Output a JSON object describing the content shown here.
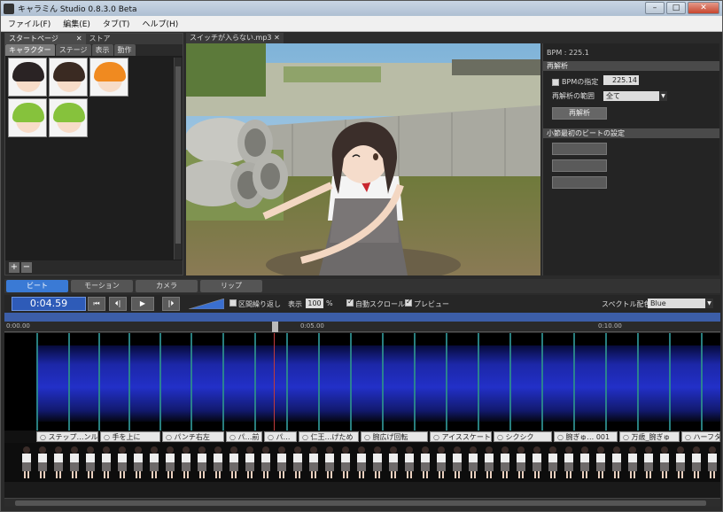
{
  "window": {
    "title": "キャラミん Studio 0.8.3.0 Beta",
    "minimize": "–",
    "maximize": "□",
    "close": "✕"
  },
  "menu": [
    "ファイル(F)",
    "編集(E)",
    "タブ(T)",
    "ヘルプ(H)"
  ],
  "left_panel": {
    "doc_tabs": [
      "スタートページ",
      "ストア"
    ],
    "tab_close": "✕",
    "sub_tabs": [
      "キャラクター",
      "ステージ",
      "表示",
      "動作"
    ],
    "characters": [
      {
        "hair": "#2a2324",
        "accent": "#e05a7a"
      },
      {
        "hair": "#3a2a22",
        "accent": "#6c4b3a"
      },
      {
        "hair": "#f08a20",
        "accent": "#fbd16a"
      },
      {
        "hair": "#86c23c",
        "accent": "#b6e07a"
      },
      {
        "hair": "#86c23c",
        "accent": "#d6e68a"
      }
    ],
    "add_label": "+",
    "remove_label": "−"
  },
  "viewport": {
    "tab_title": "スイッチが入らない.mp3",
    "tab_close": "✕"
  },
  "right_panel": {
    "bpm_text": "BPM : 225.1",
    "reanalyze_header": "再解析",
    "bpm_specify_label": "BPMの指定",
    "bpm_value": "225.14",
    "range_label": "再解析の範囲",
    "range_value": "全て",
    "reanalyze_button": "再解析",
    "first_beat_header": "小節最初のビートの設定"
  },
  "mode_tabs": [
    "ビート",
    "モーション",
    "カメラ",
    "リップ"
  ],
  "transport": {
    "time": "0:04.59",
    "to_start": "⏮",
    "prev": "⏴|",
    "play": "▶",
    "next": "|⏵",
    "loop_label": "区間繰り返し",
    "display_label": "表示",
    "zoom_pct": "100",
    "pct_unit": "%",
    "auto_scroll_label": "自動スクロール",
    "preview_label": "プレビュー",
    "spectrum_color_label": "スペクトル配色",
    "spectrum_color_value": "Blue"
  },
  "ruler_labels": [
    "0:00.00",
    "0:05.00",
    "0:10.00"
  ],
  "motions": [
    "ステップ…ンルン",
    "手を上に",
    "パンチ右左",
    "パ…前",
    "パ…",
    "仁王…げため",
    "腕広げ回転",
    "アイススケート",
    "シクシク",
    "腕ぎゅ… 001",
    "万歳_腕ぎゅ",
    "ハーフタ"
  ]
}
